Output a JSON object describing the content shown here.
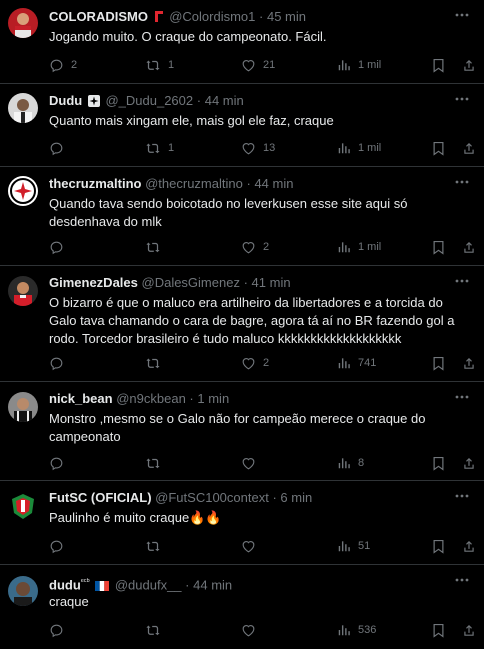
{
  "tweets": [
    {
      "name": "COLORADISMO",
      "badge": "flag",
      "handle": "@Colordismo1",
      "dot": "·",
      "time": "45 min",
      "text": "Jogando muito. O craque do campeonato. Fácil.",
      "replies": "2",
      "retweets": "1",
      "likes": "21",
      "views": "1 mil"
    },
    {
      "name": "Dudu",
      "badge": "cross",
      "handle": "@_Dudu_2602",
      "dot": "·",
      "time": "44 min",
      "text": "Quanto mais xingam ele, mais gol ele faz, craque",
      "replies": "",
      "retweets": "1",
      "likes": "13",
      "views": "1 mil"
    },
    {
      "name": "thecruzmaltino",
      "badge": "",
      "handle": "@thecruzmaltino",
      "dot": "·",
      "time": "44 min",
      "text": "Quando tava sendo boicotado no leverkusen esse site aqui só desdenhava do mlk",
      "replies": "",
      "retweets": "",
      "likes": "2",
      "views": "1 mil"
    },
    {
      "name": "GimenezDales",
      "badge": "",
      "handle": "@DalesGimenez",
      "dot": "·",
      "time": "41 min",
      "text": "O bizarro é que o maluco era artilheiro da libertadores e a torcida do Galo tava chamando o cara de bagre, agora tá aí no BR fazendo gol a rodo. Torcedor brasileiro é tudo maluco kkkkkkkkkkkkkkkkkkk",
      "replies": "",
      "retweets": "",
      "likes": "2",
      "views": "741"
    },
    {
      "name": "nick_bean",
      "badge": "",
      "handle": "@n9ckbean",
      "dot": "·",
      "time": "1 min",
      "text": "Monstro ,mesmo se o Galo não for campeão merece o craque do campeonato",
      "replies": "",
      "retweets": "",
      "likes": "",
      "views": "8"
    },
    {
      "name": "FutSC (OFICIAL)",
      "badge": "",
      "handle": "@FutSC100context",
      "dot": "·",
      "time": "6 min",
      "text": "Paulinho é muito craque🔥🔥",
      "replies": "",
      "retweets": "",
      "likes": "",
      "views": "51"
    },
    {
      "name": "dudu",
      "name_suffix": "ᵉᶜᵇ",
      "badge": "flag-fr",
      "handle": "@dudufx__",
      "dot": "·",
      "time": "44 min",
      "text": "craque",
      "replies": "",
      "retweets": "",
      "likes": "",
      "views": "536"
    }
  ],
  "colors": {
    "background": "#000000",
    "text": "#e7e9ea",
    "muted": "#71767b",
    "divider": "#2f3336"
  }
}
